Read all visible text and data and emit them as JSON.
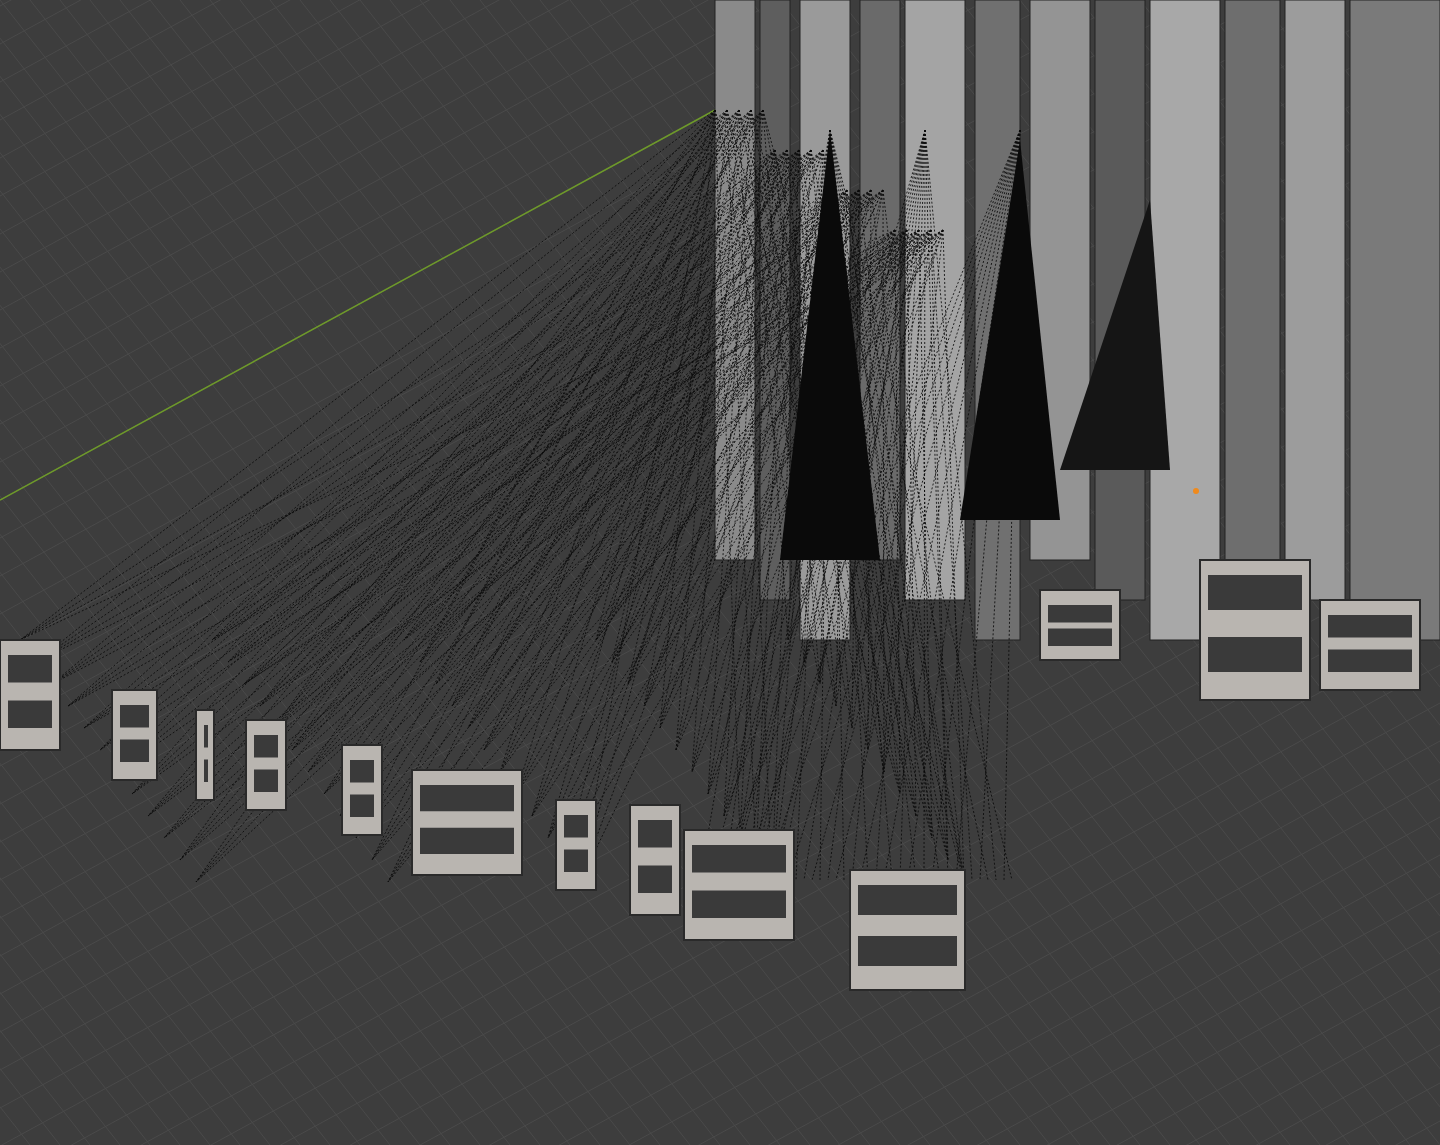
{
  "viewport": {
    "show_grid": true,
    "show_x_axis": true,
    "show_origin": true
  }
}
